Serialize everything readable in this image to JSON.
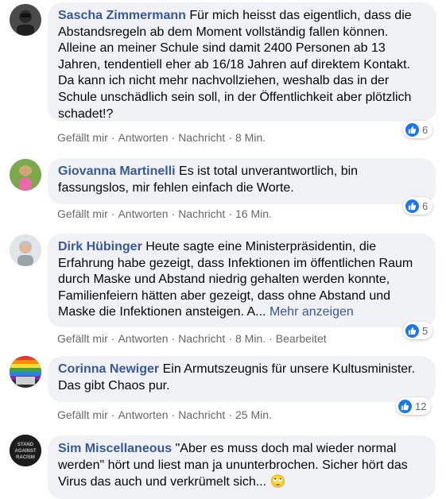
{
  "comments": [
    {
      "author": "Sascha Zimmermann",
      "text": "Für mich heisst das eigentlich, dass die Abstandsregeln ab dem Moment vollständig fallen können. Alleine an meiner Schule sind damit 2400 Personen ab 13 Jahren, tendentiell eher ab 16/18 Jahren auf direktem Kontakt. Da kann ich nicht mehr nachvollziehen, weshalb das in der Schule unschädlich sein soll, in der Öffentlichkeit aber plötzlich schadet!?",
      "like": "Gefällt mir",
      "reply": "Antworten",
      "message": "Nachricht",
      "time": "8 Min.",
      "reactions": "6"
    },
    {
      "author": "Giovanna Martinelli",
      "text": "Es ist total unverantwortlich, bin fassungslos, mir fehlen einfach die Worte.",
      "like": "Gefällt mir",
      "reply": "Antworten",
      "message": "Nachricht",
      "time": "16 Min.",
      "reactions": "6"
    },
    {
      "author": "Dirk Hübinger",
      "text": "Heute sagte eine Ministerpräsidentin, die Erfahrung habe gezeigt, dass Infektionen im öffentlichen Raum durch Maske und Abstand niedrig gehalten werden konnte, Familienfeiern hätten aber gezeigt, dass ohne Abstand und Maske die Infektionen ansteigen. A...",
      "more": "Mehr anzeigen",
      "like": "Gefällt mir",
      "reply": "Antworten",
      "message": "Nachricht",
      "time": "8 Min.",
      "edited": "Bearbeitet",
      "reactions": "5"
    },
    {
      "author": "Corinna Newiger",
      "text": "Ein Armutszeugnis für unsere Kultusminister. Das gibt Chaos pur.",
      "like": "Gefällt mir",
      "reply": "Antworten",
      "message": "Nachricht",
      "time": "25 Min.",
      "reactions": "12"
    },
    {
      "author": "Sim Miscellaneous",
      "text": "\"Aber es muss doch mal wieder normal werden\" hört und liest man ja ununterbrochen. Sicher hört das Virus das auch und verkrümelt sich...",
      "emoji": "🙄",
      "avatar_text": "STAND AGAINST RACISM"
    }
  ],
  "colors": {
    "author": "#385898",
    "bubble": "#f0f2f5",
    "meta": "#65676b",
    "like_blue": "#1877f2"
  }
}
